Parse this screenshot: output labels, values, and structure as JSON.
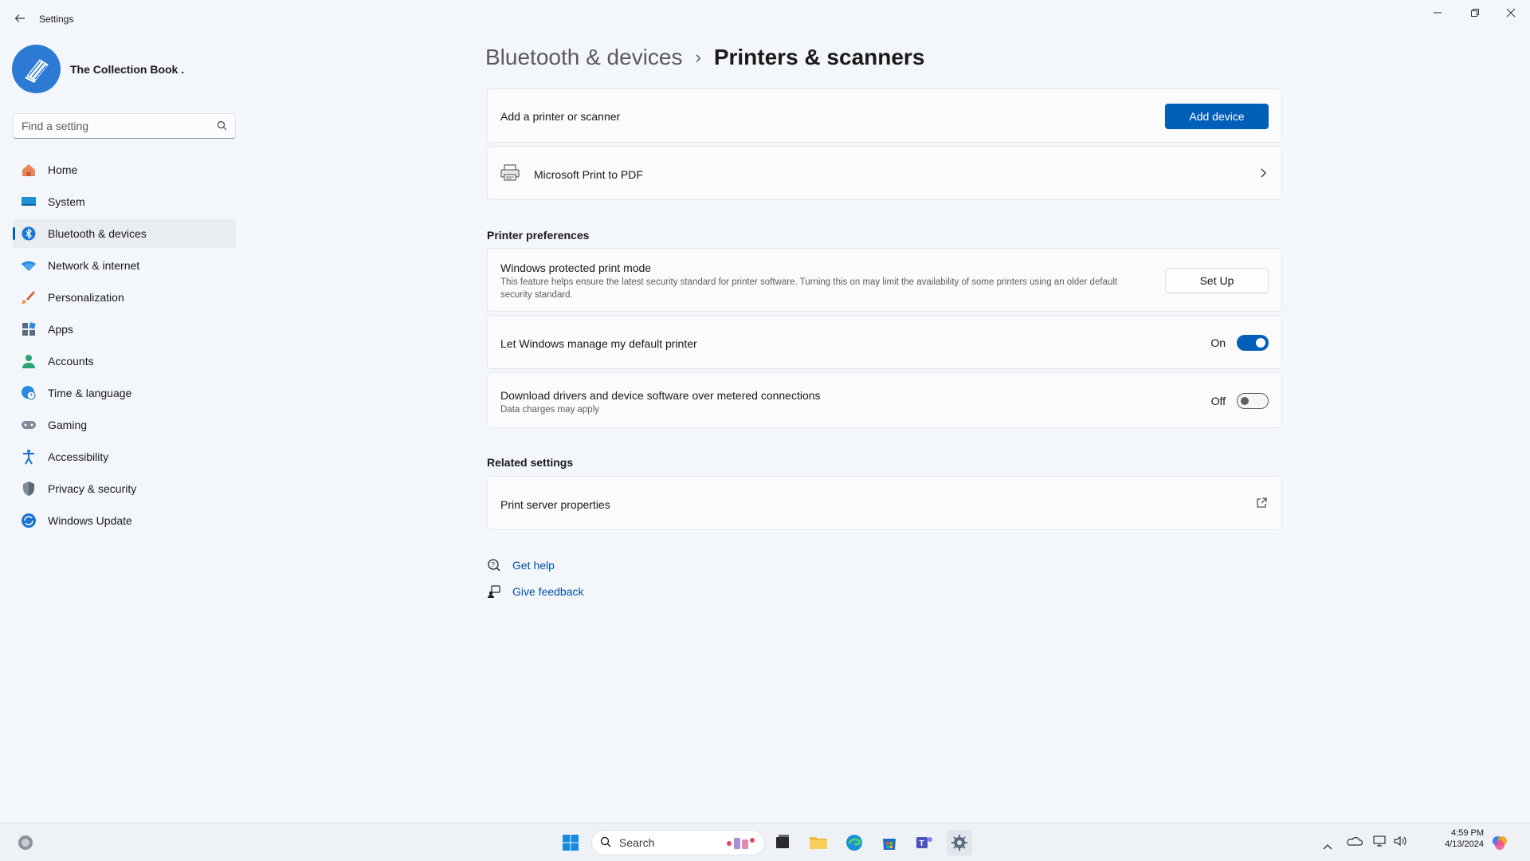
{
  "window": {
    "title": "Settings",
    "controls": [
      "minimize",
      "restore",
      "close"
    ]
  },
  "profile": {
    "name": "The Collection Book ."
  },
  "search": {
    "placeholder": "Find a setting"
  },
  "sidebar": {
    "items": [
      {
        "label": "Home",
        "icon": "home-icon"
      },
      {
        "label": "System",
        "icon": "system-icon"
      },
      {
        "label": "Bluetooth & devices",
        "icon": "bluetooth-icon",
        "active": true
      },
      {
        "label": "Network & internet",
        "icon": "wifi-icon"
      },
      {
        "label": "Personalization",
        "icon": "brush-icon"
      },
      {
        "label": "Apps",
        "icon": "apps-icon"
      },
      {
        "label": "Accounts",
        "icon": "person-icon"
      },
      {
        "label": "Time & language",
        "icon": "globe-clock-icon"
      },
      {
        "label": "Gaming",
        "icon": "gamepad-icon"
      },
      {
        "label": "Accessibility",
        "icon": "accessibility-icon"
      },
      {
        "label": "Privacy & security",
        "icon": "shield-icon"
      },
      {
        "label": "Windows Update",
        "icon": "update-icon"
      }
    ]
  },
  "breadcrumb": {
    "parent": "Bluetooth & devices",
    "separator": "›",
    "current": "Printers & scanners"
  },
  "add_printer": {
    "label": "Add a printer or scanner",
    "button": "Add device"
  },
  "printers": [
    {
      "name": "Microsoft Print to PDF"
    }
  ],
  "preferences": {
    "title": "Printer preferences",
    "protected_mode": {
      "title": "Windows protected print mode",
      "description": "This feature helps ensure the latest security standard for printer software. Turning this on may limit the availability of some printers using an older default security standard.",
      "button": "Set Up"
    },
    "manage_default": {
      "title": "Let Windows manage my default printer",
      "state_label": "On",
      "on": true
    },
    "metered": {
      "title": "Download drivers and device software over metered connections",
      "subtitle": "Data charges may apply",
      "state_label": "Off",
      "on": false
    }
  },
  "related": {
    "title": "Related settings",
    "items": [
      {
        "label": "Print server properties"
      }
    ]
  },
  "help": {
    "get_help": "Get help",
    "give_feedback": "Give feedback"
  },
  "taskbar": {
    "search_label": "Search",
    "time": "4:59 PM",
    "date": "4/13/2024"
  },
  "colors": {
    "accent": "#005fb8",
    "background": "#f3f6fb",
    "card": "#fbfbfc"
  }
}
